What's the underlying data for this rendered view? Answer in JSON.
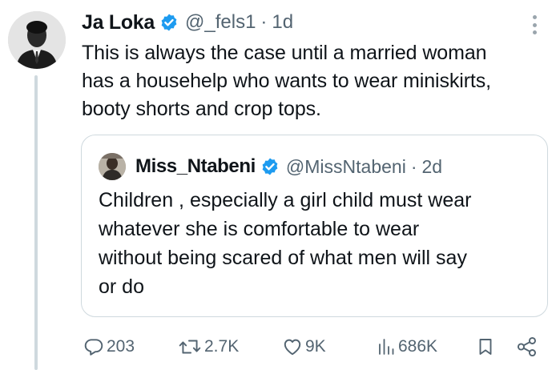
{
  "colors": {
    "verified": "#1d9bf0",
    "text": "#0f1419",
    "muted": "#536471",
    "border": "#cfd9de"
  },
  "tweet": {
    "author_name": "Ja Loka",
    "handle": "@_fels1",
    "separator": "·",
    "time": "1d",
    "text": "This is always the case until a married woman\nhas a househelp who wants to wear miniskirts,\nbooty shorts and crop tops."
  },
  "quoted_tweet": {
    "author_name": "Miss_Ntabeni",
    "handle": "@MissNtabeni",
    "separator": "·",
    "time": "2d",
    "text": "Children , especially a girl child must wear\nwhatever she is comfortable to wear\nwithout being scared of what men will say\nor do"
  },
  "actions": {
    "replies": "203",
    "retweets": "2.7K",
    "likes": "9K",
    "views": "686K"
  },
  "icons": [
    "more-icon",
    "verified-icon",
    "reply-icon",
    "retweet-icon",
    "like-icon",
    "views-icon",
    "bookmark-icon",
    "share-icon"
  ]
}
